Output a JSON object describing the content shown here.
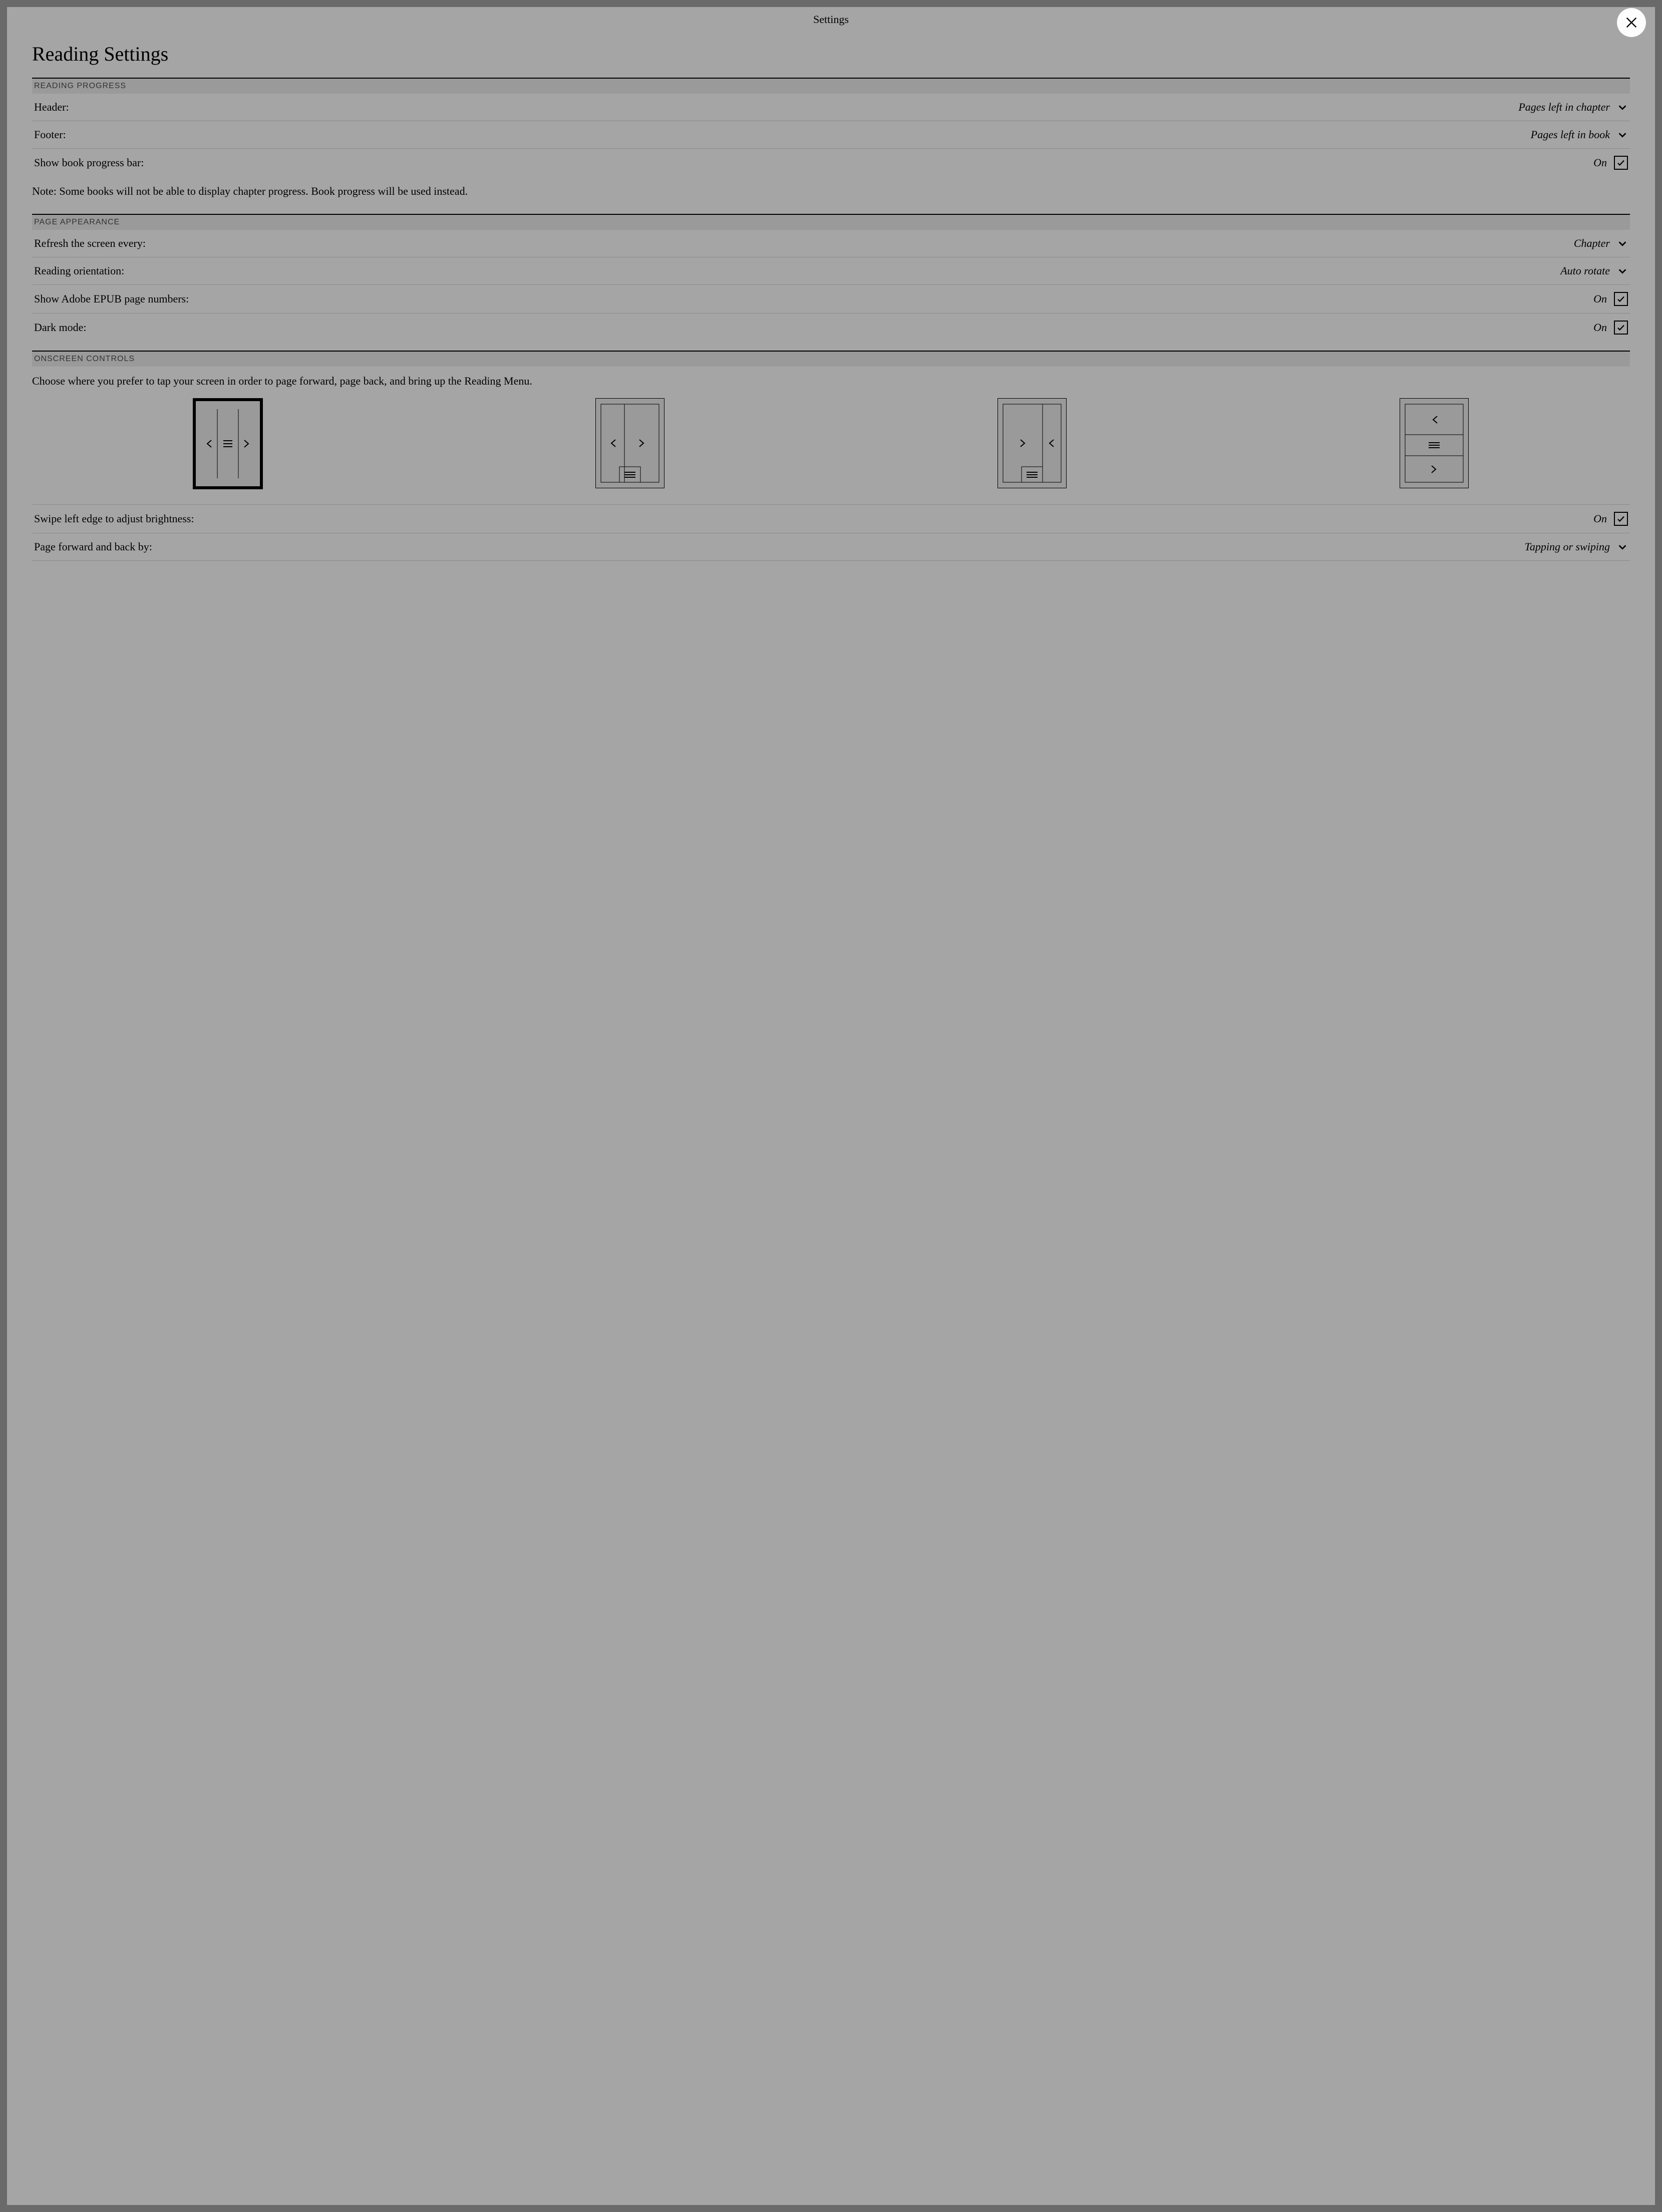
{
  "topbar": {
    "title": "Settings"
  },
  "page": {
    "title": "Reading Settings"
  },
  "sections": {
    "progress": {
      "title": "READING PROGRESS",
      "header_label": "Header:",
      "header_value": "Pages left in chapter",
      "footer_label": "Footer:",
      "footer_value": "Pages left in book",
      "progressbar_label": "Show book progress bar:",
      "progressbar_value": "On",
      "note": "Note: Some books will not be able to display chapter progress. Book progress will be used instead."
    },
    "appearance": {
      "title": "PAGE APPEARANCE",
      "refresh_label": "Refresh the screen every:",
      "refresh_value": "Chapter",
      "orientation_label": "Reading orientation:",
      "orientation_value": "Auto rotate",
      "adobe_label": "Show Adobe EPUB page numbers:",
      "adobe_value": "On",
      "dark_label": "Dark mode:",
      "dark_value": "On"
    },
    "controls": {
      "title": "ONSCREEN CONTROLS",
      "instruction": "Choose where you prefer to tap your screen in order to page forward, page back, and bring up the Reading Menu.",
      "brightness_label": "Swipe left edge to adjust brightness:",
      "brightness_value": "On",
      "pageturn_label": "Page forward and back by:",
      "pageturn_value": "Tapping or swiping",
      "selected_layout": 0
    }
  }
}
